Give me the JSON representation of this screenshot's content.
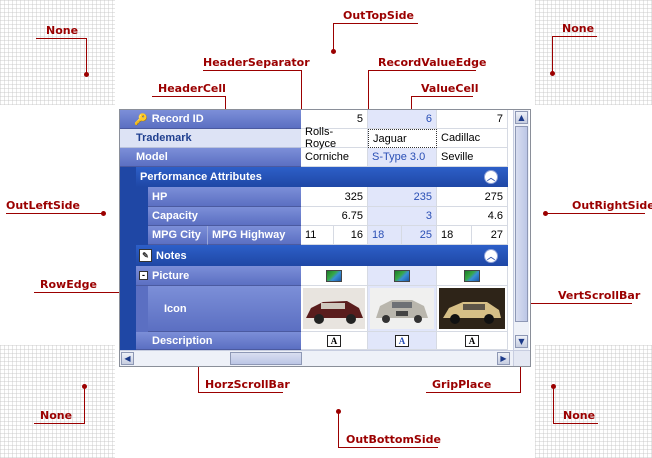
{
  "annotations": {
    "none_tl": "None",
    "out_top": "OutTopSide",
    "none_tr": "None",
    "header_separator": "HeaderSeparator",
    "record_value_edge": "RecordValueEdge",
    "header_cell": "HeaderCell",
    "value_cell": "ValueCell",
    "out_left": "OutLeftSide",
    "out_right": "OutRightSide",
    "row_edge": "RowEdge",
    "vert_scroll": "VertScrollBar",
    "horz_scroll": "HorzScrollBar",
    "grip_place": "GripPlace",
    "none_bl": "None",
    "out_bottom": "OutBottomSide",
    "none_br": "None"
  },
  "grid": {
    "record_id_label": "Record ID",
    "record_ids": [
      "5",
      "6",
      "7"
    ],
    "trademark_label": "Trademark",
    "trademarks": [
      "Rolls-Royce",
      "Jaguar",
      "Cadillac"
    ],
    "model_label": "Model",
    "models": [
      "Corniche",
      "S-Type 3.0",
      "Seville"
    ],
    "perf_category": "Performance Attributes",
    "hp_label": "HP",
    "hp": [
      "325",
      "235",
      "275"
    ],
    "capacity_label": "Capacity",
    "capacity": [
      "6.75",
      "3",
      "4.6"
    ],
    "mpg_city_label": "MPG City",
    "mpg_highway_label": "MPG Highway",
    "mpg_city": [
      "11",
      "18",
      "18"
    ],
    "mpg_highway": [
      "16",
      "25",
      "27"
    ],
    "notes_category": "Notes",
    "picture_label": "Picture",
    "icon_label": "Icon",
    "description_label": "Description"
  },
  "colors": {
    "accent": "#9b0000",
    "header_dark": "#5b6fc2",
    "category": "#1f47a5"
  }
}
